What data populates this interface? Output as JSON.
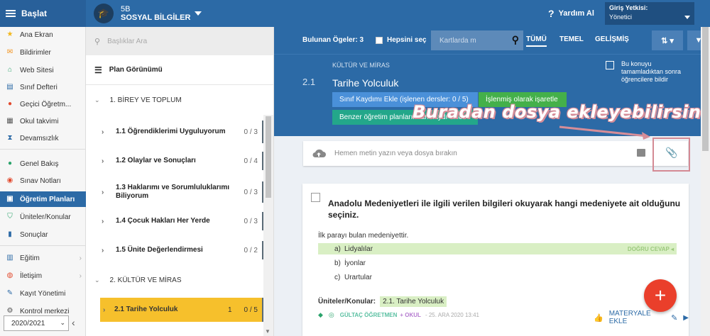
{
  "topbar": {
    "brand": "Başlat",
    "course_code": "5B",
    "course_name": "SOSYAL BİLGİLER",
    "help": "Yardım Al",
    "auth_label": "Giriş Yetkisi:",
    "auth_value": "Yönetici"
  },
  "leftnav": {
    "items": [
      {
        "label": "Ana Ekran",
        "icon": "star-icon",
        "color": "#f2b619"
      },
      {
        "label": "Bildirimler",
        "icon": "mail-icon",
        "color": "#f29119"
      },
      {
        "label": "Web Sitesi",
        "icon": "home-icon",
        "color": "#2aa36b"
      },
      {
        "label": "Sınıf Defteri",
        "icon": "notebook-icon",
        "color": "#2c6aa6"
      },
      {
        "label": "Geçici Öğretm...",
        "icon": "user-icon",
        "color": "#e24a2e"
      },
      {
        "label": "Okul takvimi",
        "icon": "calendar-icon",
        "color": "#555555"
      },
      {
        "label": "Devamsızlık",
        "icon": "hourglass-icon",
        "color": "#2c6aa6"
      },
      {
        "label": "Genel Bakış",
        "icon": "circle-icon",
        "color": "#2aa36b"
      },
      {
        "label": "Sınav Notları",
        "icon": "exam-icon",
        "color": "#e24a2e"
      },
      {
        "label": "Öğretim Planları",
        "icon": "briefcase-icon",
        "color": "#ffffff"
      },
      {
        "label": "Üniteler/Konular",
        "icon": "shield-check-icon",
        "color": "#2aa36b"
      },
      {
        "label": "Sonuçlar",
        "icon": "bar-chart-icon",
        "color": "#2c6aa6"
      },
      {
        "label": "Eğitim",
        "icon": "education-icon",
        "color": "#2c6aa6"
      },
      {
        "label": "İletişim",
        "icon": "chat-icon",
        "color": "#e24a2e"
      },
      {
        "label": "Kayıt Yönetimi",
        "icon": "pencil-icon",
        "color": "#2c6aa6"
      },
      {
        "label": "Kontrol merkezi",
        "icon": "gear-icon",
        "color": "#555555"
      }
    ],
    "year": "2020/2021"
  },
  "mid": {
    "search_placeholder": "Başlıklar Ara",
    "plan_view": "Plan Görünümü",
    "sections": [
      {
        "title": "1. BİREY VE TOPLUM"
      },
      {
        "title": "2. KÜLTÜR VE MİRAS"
      }
    ],
    "topics": [
      {
        "title": "1.1 Öğrendiklerimi Uyguluyorum",
        "count": "0 / 3"
      },
      {
        "title": "1.2 Olaylar ve Sonuçları",
        "count": "0 / 4"
      },
      {
        "title": "1.3 Haklarımı ve Sorumluluklarımı Biliyorum",
        "count": "0 / 3"
      },
      {
        "title": "1.4 Çocuk Hakları Her Yerde",
        "count": "0 / 3"
      },
      {
        "title": "1.5 Ünite Değerlendirmesi",
        "count": "0 / 2"
      },
      {
        "title": "2.1 Tarihe Yolculuk",
        "count": "0 / 5",
        "extra": "1"
      }
    ]
  },
  "right": {
    "found": "Bulunan Ögeler: 3",
    "select_all": "Hepsini seç",
    "card_search_placeholder": "Kartlarda m",
    "tabs": [
      "TÜMÜ",
      "TEMEL",
      "GELİŞMİŞ"
    ],
    "unit": "KÜLTÜR VE MİRAS",
    "topic_no": "2.1",
    "topic_title": "Tarihe Yolculuk",
    "btn_class_record": "Sınıf Kaydımı Ekle (işlenen dersler: 0 / 5)",
    "btn_mark_done": "İşlenmiş olarak işaretle",
    "btn_similar": "Benzer öğretim planlarından kaydı ekle",
    "done_checkbox_line1": "Bu konuyu",
    "done_checkbox_line2": "tamamladıktan sonra",
    "done_checkbox_line3": "öğrencilere bildir",
    "annotation": "Buradan dosya ekleyebilirsiniz",
    "upload_placeholder": "Hemen metin yazın veya dosya bırakın",
    "question": {
      "title": "Anadolu Medeniyetleri ile ilgili verilen bilgileri okuyarak hangi medeniyete ait olduğunu seçiniz.",
      "stem": "İlk parayı bulan medeniyettir.",
      "options": [
        {
          "letter": "a)",
          "text": "Lidyalılar",
          "correct": true
        },
        {
          "letter": "b)",
          "text": "İyonlar",
          "correct": false
        },
        {
          "letter": "c)",
          "text": "Urartular",
          "correct": false
        }
      ],
      "correct_label": "DOĞRU CEVAP",
      "units_label": "Üniteler/Konular:",
      "units_tag": "2.1. Tarihe Yolculuk",
      "teacher": "GÜLTAÇ ÖĞRETMEN",
      "okul": "+ OKUL",
      "date": "- 25. ARA 2020 13:41",
      "add_material": "MATERYALE EKLE"
    },
    "fab": "+"
  }
}
